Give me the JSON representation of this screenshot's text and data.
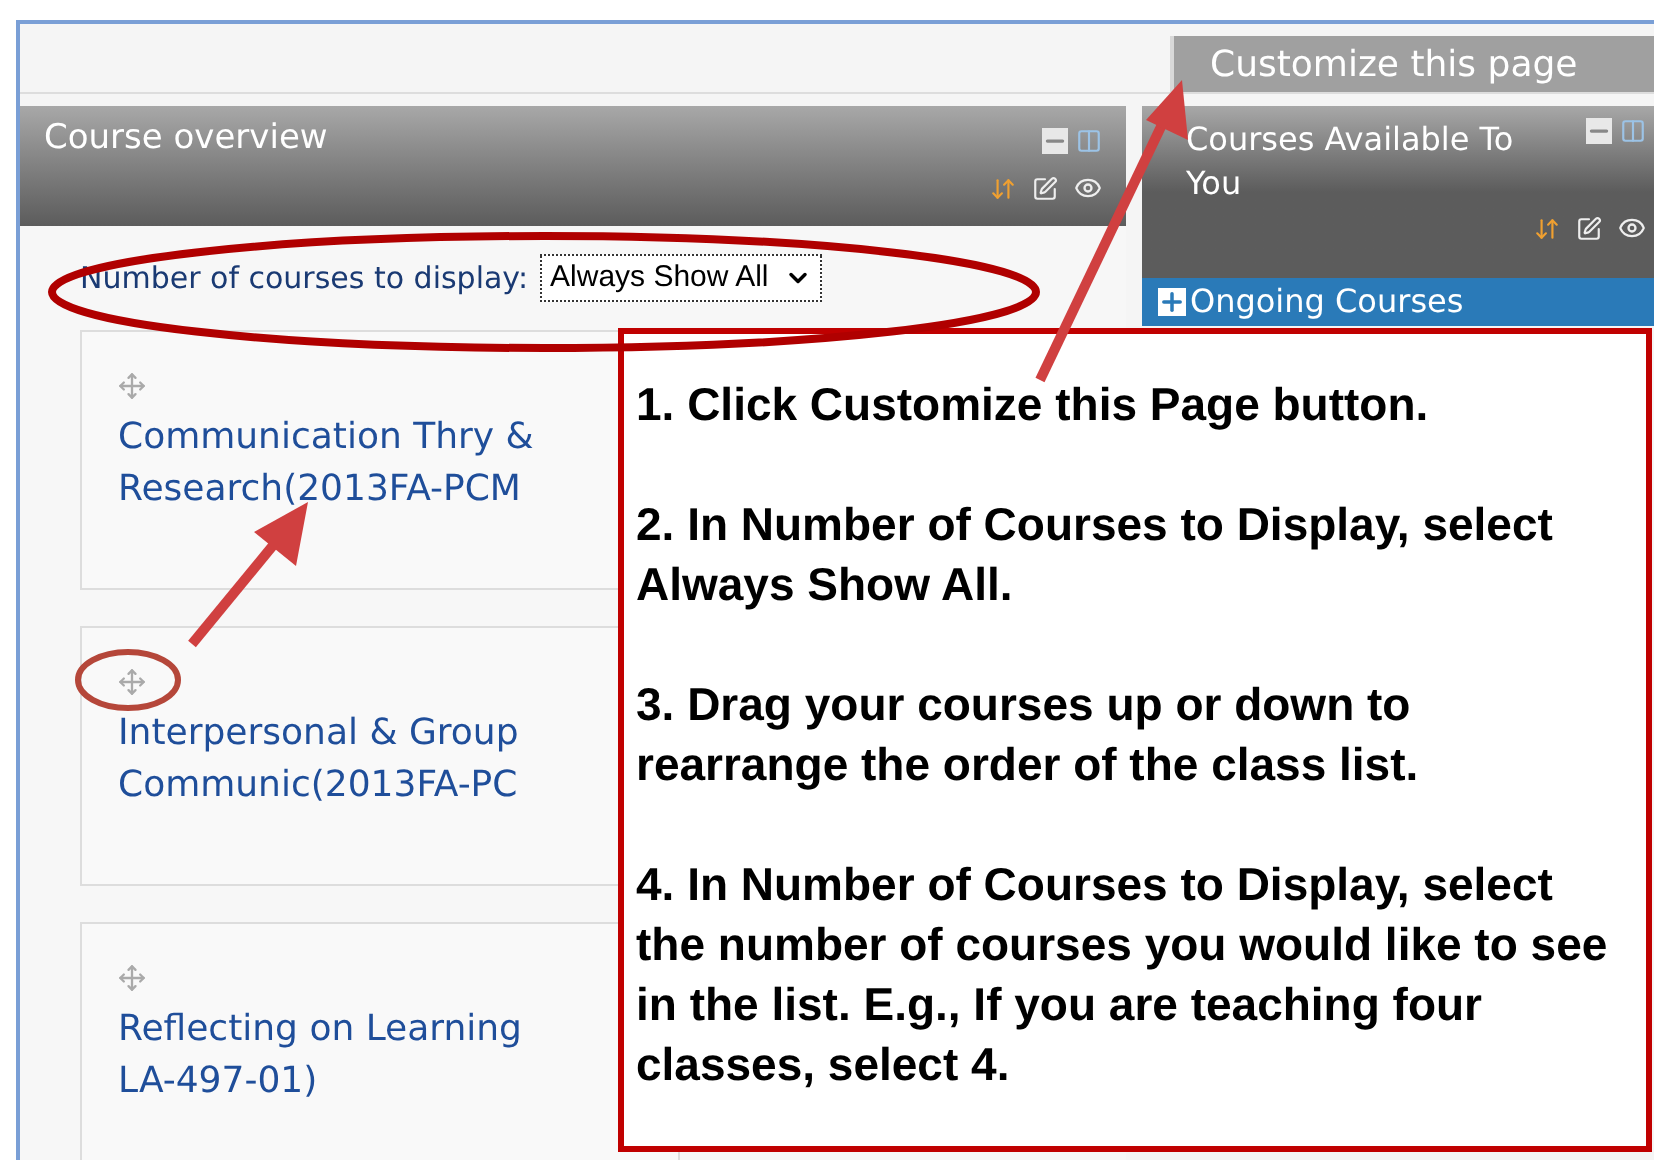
{
  "page_header": {
    "customize_button": "Customize this page"
  },
  "course_overview": {
    "title": "Course overview",
    "display_select": {
      "label": "Number of courses to display:",
      "value": "Always Show All"
    },
    "courses": [
      {
        "name": "Communication Thry &\nResearch(2013FA-PCM"
      },
      {
        "name": "Interpersonal & Group\nCommunic(2013FA-PC"
      },
      {
        "name": "Reflecting on Learning\nLA-497-01)"
      }
    ]
  },
  "courses_available": {
    "title": "Courses Available To You",
    "categories": [
      {
        "name": "Ongoing Courses",
        "expanded": false
      }
    ]
  },
  "callout": {
    "steps": [
      "1. Click Customize this Page button.",
      "2. In Number of Courses to Display, select Always Show All.",
      "3. Drag your courses up or down to rearrange the order of the class list.",
      "4. In Number of Courses to Display, select the number of courses you would like to see in the list. E.g., If you are teaching four classes, select 4."
    ]
  }
}
